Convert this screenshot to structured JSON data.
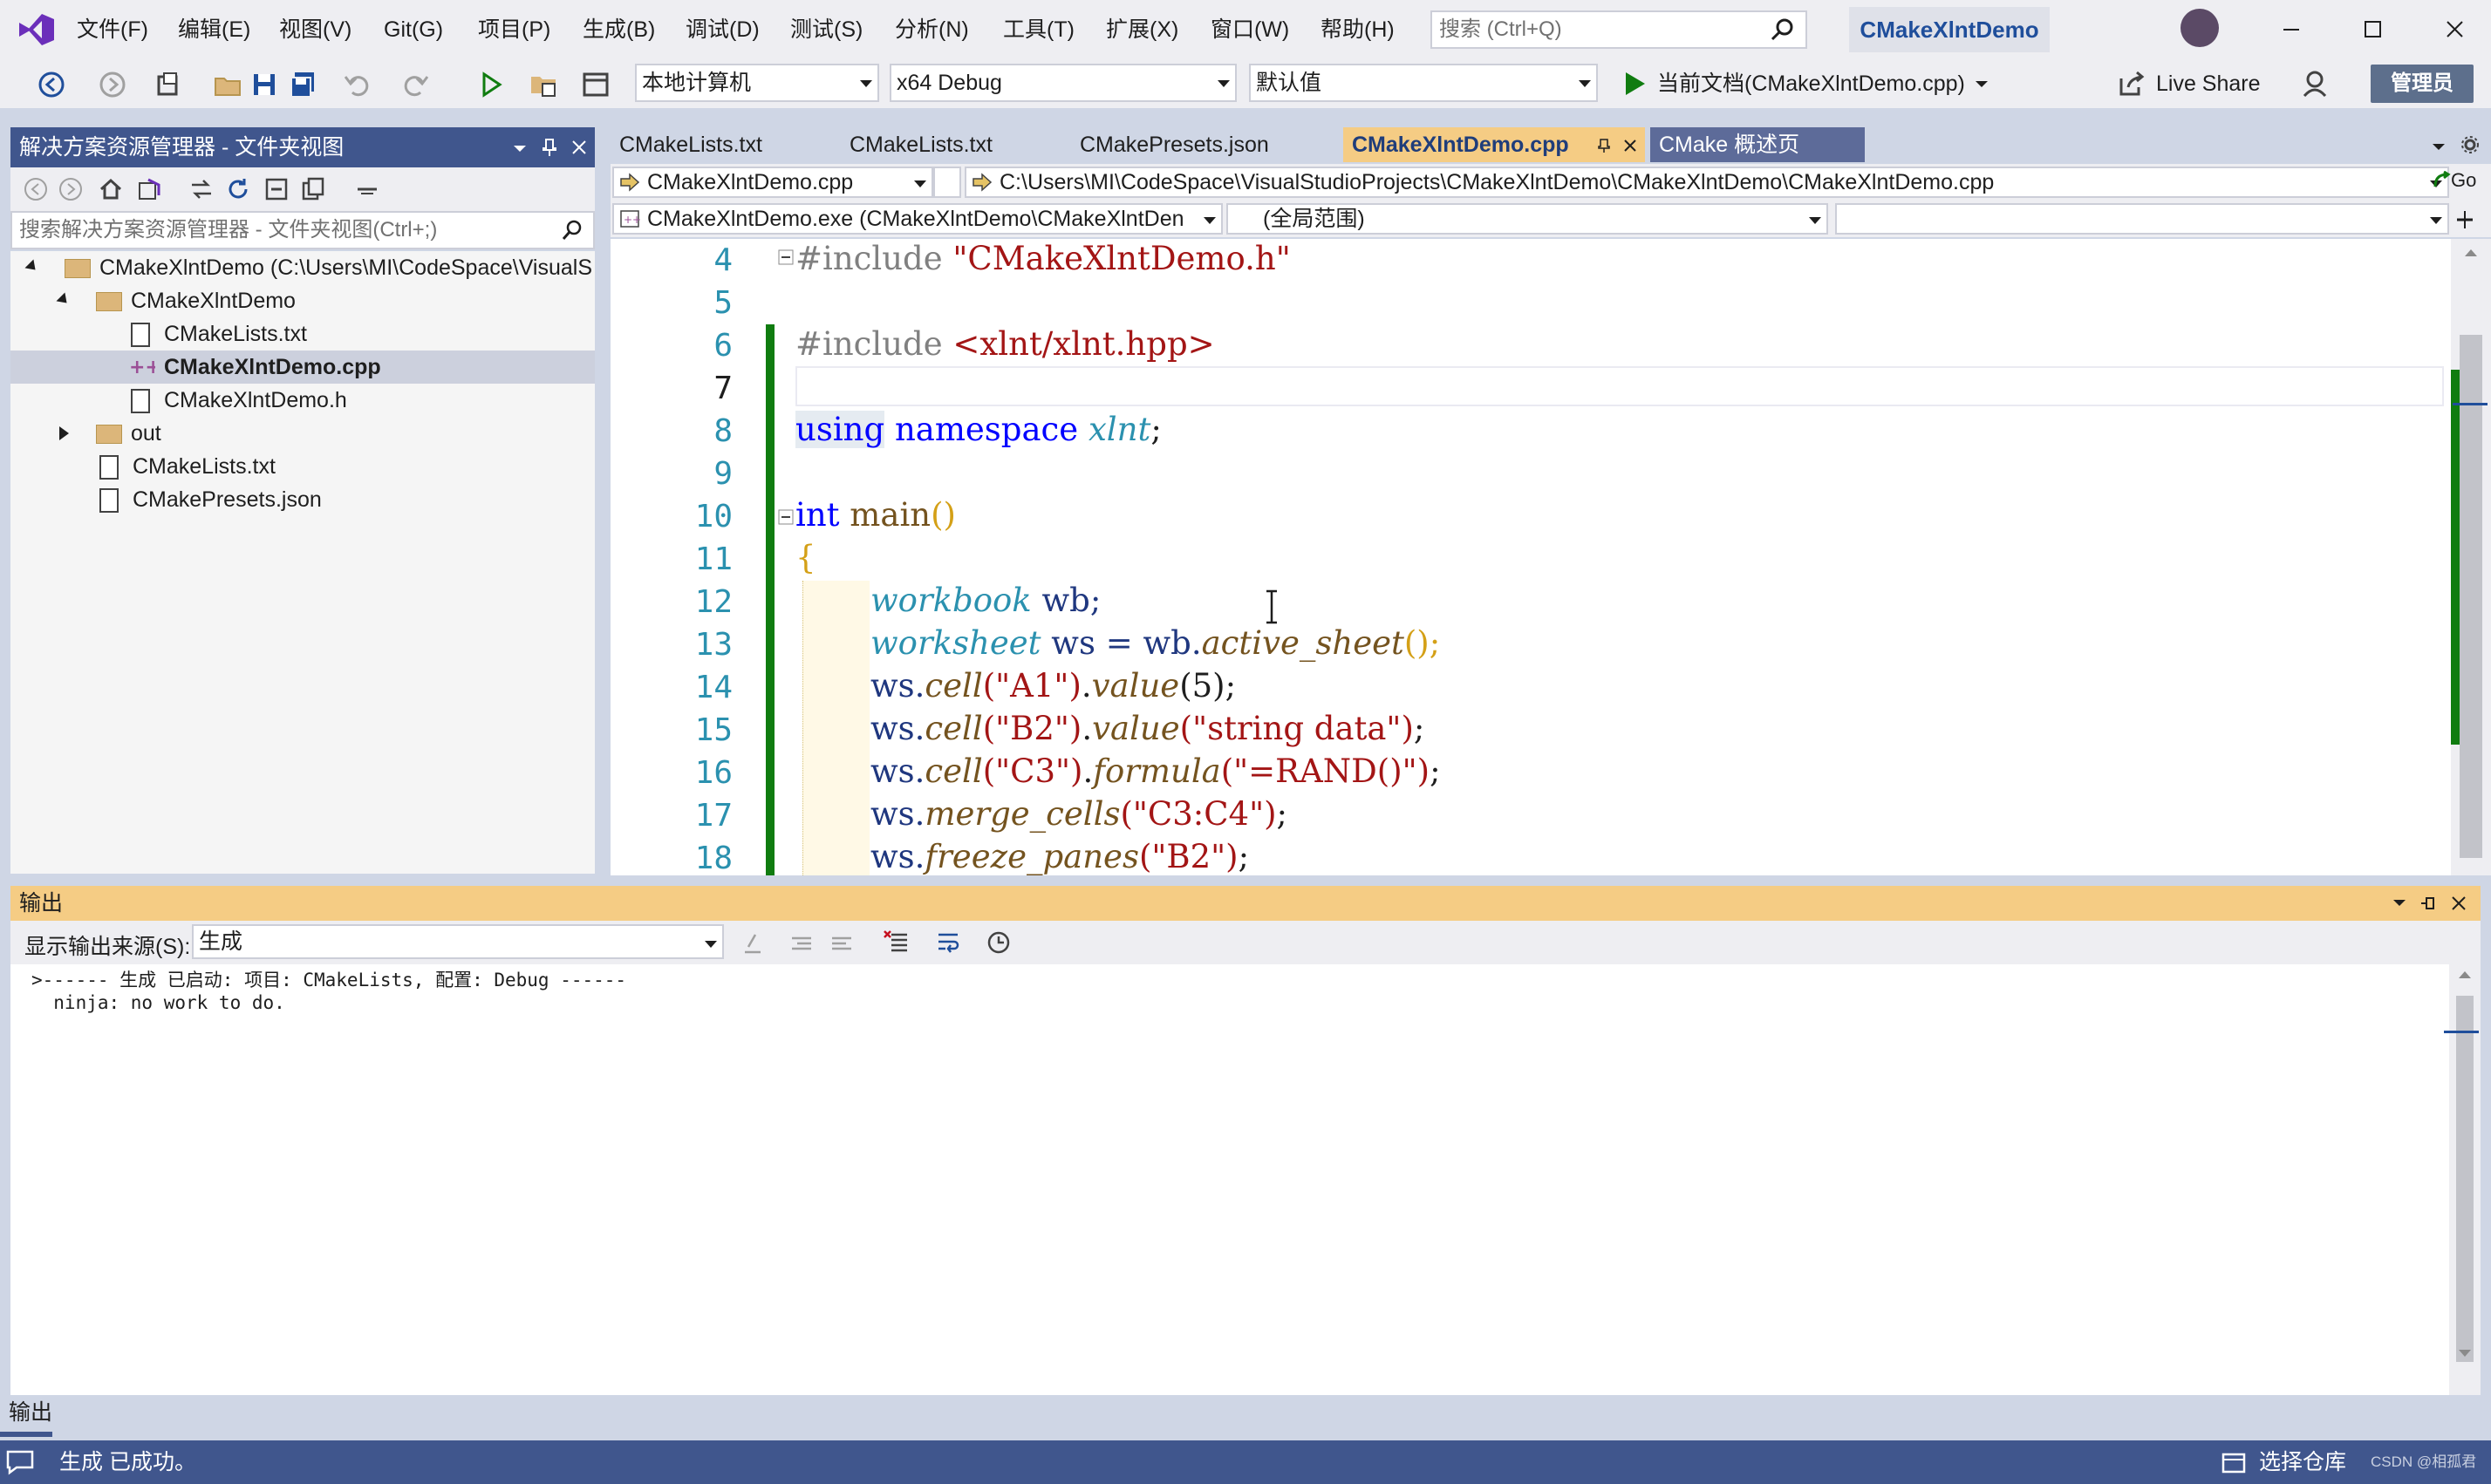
{
  "menu": {
    "items": [
      "文件(F)",
      "编辑(E)",
      "视图(V)",
      "Git(G)",
      "项目(P)",
      "生成(B)",
      "调试(D)",
      "测试(S)",
      "分析(N)",
      "工具(T)",
      "扩展(X)",
      "窗口(W)",
      "帮助(H)"
    ],
    "search_placeholder": "搜索 (Ctrl+Q)",
    "solution_title": "CMakeXlntDemo"
  },
  "toolbar": {
    "target_combo": "本地计算机",
    "config_combo": "x64 Debug",
    "default_combo": "默认值",
    "run_label": "当前文档(CMakeXlntDemo.cpp)",
    "liveshare_label": "Live Share",
    "admin_label": "管理员"
  },
  "solution_explorer": {
    "title": "解决方案资源管理器 - 文件夹视图",
    "search_placeholder": "搜索解决方案资源管理器 - 文件夹视图(Ctrl+;)",
    "tree": {
      "root": "CMakeXlntDemo (C:\\Users\\MI\\CodeSpace\\VisualS",
      "folder1": "CMakeXlntDemo",
      "f1": "CMakeLists.txt",
      "f2": "CMakeXlntDemo.cpp",
      "f3": "CMakeXlntDemo.h",
      "folder2": "out",
      "f4": "CMakeLists.txt",
      "f5": "CMakePresets.json"
    }
  },
  "editor": {
    "tabs": [
      "CMakeLists.txt",
      "CMakeLists.txt",
      "CMakePresets.json",
      "CMakeXlntDemo.cpp",
      "CMake 概述页"
    ],
    "nav_file": "CMakeXlntDemo.cpp",
    "nav_path": "C:\\Users\\MI\\CodeSpace\\VisualStudioProjects\\CMakeXlntDemo\\CMakeXlntDemo\\CMakeXlntDemo.cpp",
    "nav_go": "Go",
    "nav_target": "CMakeXlntDemo.exe (CMakeXlntDemo\\CMakeXlntDen",
    "nav_scope": "(全局范围)",
    "line_numbers": [
      "4",
      "5",
      "6",
      "7",
      "8",
      "9",
      "10",
      "11",
      "12",
      "13",
      "14",
      "15",
      "16",
      "17",
      "18"
    ],
    "code": {
      "l4_kw": "#include ",
      "l4_str": "\"CMakeXlntDemo.h\"",
      "l6_kw": "#include ",
      "l6_str": "<xlnt/xlnt.hpp>",
      "l8_using": "using",
      "l8_ns": "namespace",
      "l8_id": "xlnt",
      "l8_end": ";",
      "l10_int": "int",
      "l10_main": " main",
      "l10_paren": "()",
      "l11": "{",
      "l12_type": "workbook",
      "l12_rest": " wb;",
      "l13_type": "worksheet",
      "l13_mid": " ws = wb.",
      "l13_fn": "active_sheet",
      "l13_end": "();",
      "l14_a": "ws.",
      "l14_fn": "cell",
      "l14_str": "(\"A1\")",
      "l14_b": ".",
      "l14_fn2": "value",
      "l14_c": "(5);",
      "l15_a": "ws.",
      "l15_fn": "cell",
      "l15_str": "(\"B2\")",
      "l15_b": ".",
      "l15_fn2": "value",
      "l15_str2": "(\"string data\")",
      "l15_c": ";",
      "l16_a": "ws.",
      "l16_fn": "cell",
      "l16_str": "(\"C3\")",
      "l16_b": ".",
      "l16_fn2": "formula",
      "l16_str2": "(\"=RAND()\")",
      "l16_c": ";",
      "l17_a": "ws.",
      "l17_fn": "merge_cells",
      "l17_str": "(\"C3:C4\")",
      "l17_c": ";",
      "l18_a": "ws.",
      "l18_fn": "freeze_panes",
      "l18_str": "(\"B2\")",
      "l18_c": ";"
    }
  },
  "output": {
    "title": "输出",
    "source_label": "显示输出来源(S):",
    "source_value": "生成",
    "lines": [
      ">------ 生成 已启动: 项目: CMakeLists, 配置: Debug ------",
      "  ninja: no work to do."
    ]
  },
  "bottom_tab": "输出",
  "status": {
    "message": "生成 已成功。",
    "repo": "选择仓库",
    "watermark": "CSDN @相孤君"
  },
  "colors": {
    "accent": "#40568d",
    "active_tab": "#f5cc84",
    "keyword": "#0000ff",
    "type": "#2b91af",
    "string": "#a31515",
    "function": "#74531f",
    "change_bar": "#107c10"
  }
}
